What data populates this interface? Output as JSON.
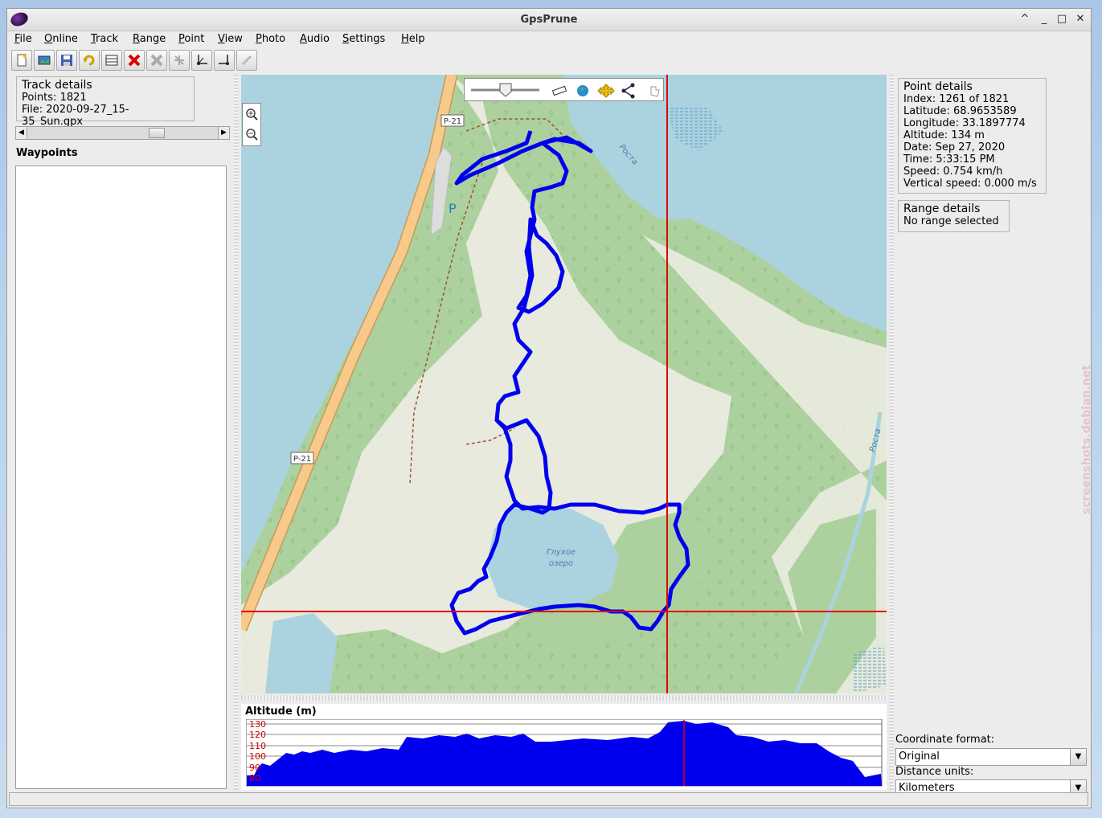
{
  "window": {
    "title": "GpsPrune",
    "controls": [
      "^",
      "_",
      "□",
      "✕"
    ]
  },
  "menu": [
    "File",
    "Online",
    "Track",
    "Range",
    "Point",
    "View",
    "Photo",
    "Audio",
    "Settings",
    "Help"
  ],
  "toolbar_icons": [
    "new-file-icon",
    "open-photo-icon",
    "save-icon",
    "undo-icon",
    "table-icon",
    "delete-point-icon",
    "delete-range-icon",
    "compress-icon",
    "set-range-start-icon",
    "set-range-end-icon",
    "connect-icon"
  ],
  "track_details": {
    "title": "Track details",
    "points": "Points: 1821",
    "file": "File: 2020-09-27_15-35_Sun.gpx"
  },
  "waypoints": {
    "title": "Waypoints",
    "items": []
  },
  "map": {
    "labels": {
      "road_label_1": "P-21",
      "road_label_2": "P-21",
      "parking": "P",
      "river_1": "Ростa",
      "river_2": "Ростa",
      "lake_line1": "Глухое",
      "lake_line2": "озеро"
    },
    "controls": [
      "zoom-slider",
      "ruler-icon",
      "globe-icon",
      "pan-icon",
      "share-icon",
      "hand-icon"
    ],
    "colors": {
      "track": "#0000ee",
      "crosshair": "#e00000",
      "forest": "#add19e",
      "water": "#aad3df",
      "clearing": "#f2efe9",
      "road": "#f7c98b"
    }
  },
  "altitude": {
    "title": "Altitude (m)",
    "ticks": [
      "130",
      "120",
      "110",
      "100",
      "90",
      "80"
    ],
    "colors": {
      "fill": "#0000ee",
      "ticks": "#cc0000",
      "marker": "#e00000"
    }
  },
  "point_details": {
    "title": "Point details",
    "lines": [
      "Index: 1261 of 1821",
      "Latitude: 68.9653589",
      "Longitude: 33.1897774",
      "Altitude: 134 m",
      "Date: Sep 27, 2020",
      "Time: 5:33:15 PM",
      "Speed: 0.754 km/h",
      "Vertical speed: 0.000 m/s"
    ]
  },
  "range_details": {
    "title": "Range details",
    "text": "No range selected"
  },
  "settings": {
    "coord_label": "Coordinate format:",
    "coord_value": "Original",
    "units_label": "Distance units:",
    "units_value": "Kilometers"
  },
  "watermark": "screenshots.debian.net"
}
